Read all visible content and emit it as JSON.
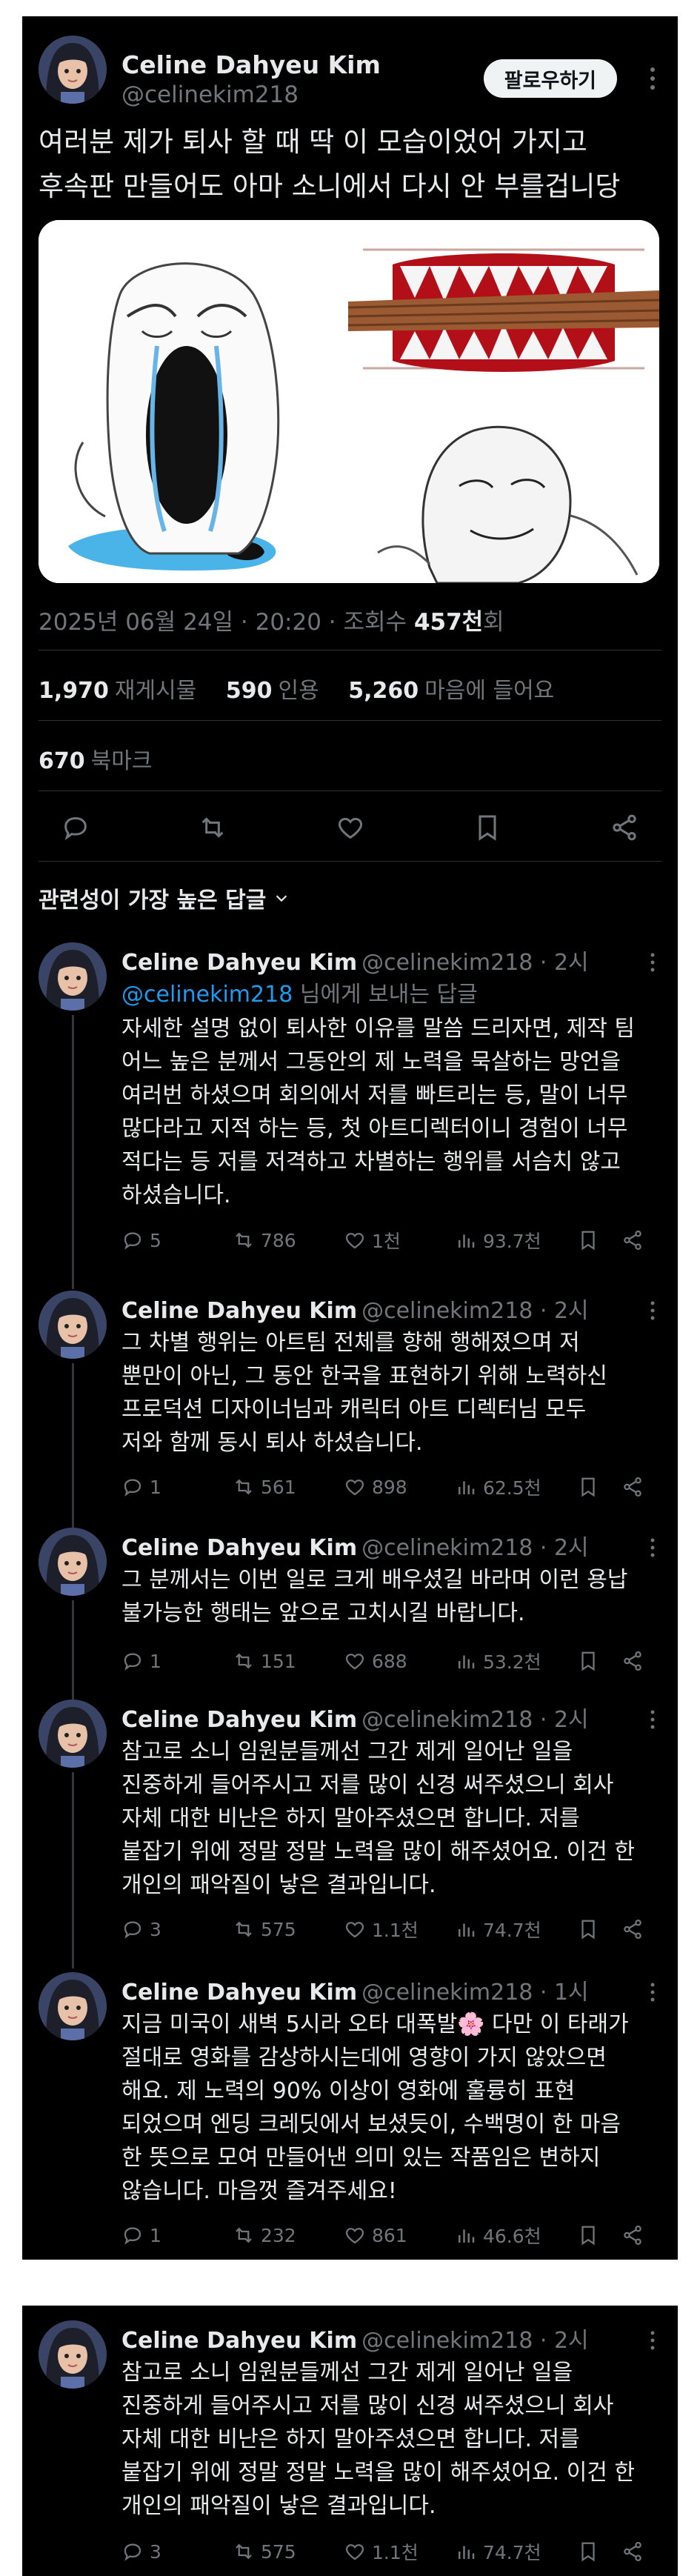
{
  "main": {
    "author_name": "Celine Dahyeu Kim",
    "author_handle": "@celinekim218",
    "follow_label": "팔로우하기",
    "text_line1": "여러분 제가 퇴사 할 때 딱 이 모습이었어 가지고",
    "text_line2": "후속판 만들어도 아마 소니에서 다시 안 부를겁니당",
    "date": "2025년 06월 24일 · 20:20 · 조회수 ",
    "views_value": "457천",
    "views_suffix": "회",
    "retweets_value": "1,970",
    "retweets_label": "재게시물",
    "quotes_value": "590",
    "quotes_label": "인용",
    "likes_value": "5,260",
    "likes_label": "마음에 들어요",
    "bookmarks_value": "670",
    "bookmarks_label": "북마크"
  },
  "sort_label": "관련성이 가장 높은 답글",
  "replies": [
    {
      "name": "Celine Dahyeu Kim",
      "handle": "@celinekim218 · 2시",
      "reply_to": "@celinekim218",
      "reply_to_suffix": " 님에게 보내는 답글",
      "lines": [
        "자세한 설명 없이 퇴사한 이유를 말씀 드리자면, 제작 팀",
        "어느 높은 분께서 그동안의 제 노력을 묵살하는 망언을",
        "여러번 하셨으며 회의에서 저를 빠트리는 등, 말이 너무",
        "많다라고 지적 하는 등, 첫 아트디렉터이니 경험이 너무",
        "적다는 등 저를 저격하고 차별하는 행위를 서슴치 않고",
        "하셨습니다."
      ],
      "replies": "5",
      "retweets": "786",
      "likes": "1천",
      "views": "93.7천"
    },
    {
      "name": "Celine Dahyeu Kim",
      "handle": "@celinekim218 · 2시",
      "lines": [
        "그 차별 행위는 아트팀 전체를 향해 행해졌으며 저",
        "뿐만이 아닌, 그 동안 한국을 표현하기 위해 노력하신",
        "프로덕션 디자이너님과 캐릭터 아트 디렉터님 모두",
        "저와 함께 동시 퇴사 하셨습니다."
      ],
      "replies": "1",
      "retweets": "561",
      "likes": "898",
      "views": "62.5천"
    },
    {
      "name": "Celine Dahyeu Kim",
      "handle": "@celinekim218 · 2시",
      "lines": [
        "그 분께서는 이번 일로 크게 배우셨길 바라며 이런 용납",
        "불가능한 행태는 앞으로 고치시길 바랍니다."
      ],
      "replies": "1",
      "retweets": "151",
      "likes": "688",
      "views": "53.2천"
    },
    {
      "name": "Celine Dahyeu Kim",
      "handle": "@celinekim218 · 2시",
      "lines": [
        "참고로 소니 임원분들께선 그간 제게 일어난 일을",
        "진중하게 들어주시고 저를 많이 신경 써주셨으니 회사",
        "자체 대한 비난은 하지 말아주셨으면 합니다. 저를",
        "붙잡기 위에 정말 정말 노력을 많이 해주셨어요. 이건 한",
        "개인의 패악질이 낳은 결과입니다."
      ],
      "replies": "3",
      "retweets": "575",
      "likes": "1.1천",
      "views": "74.7천"
    },
    {
      "name": "Celine Dahyeu Kim",
      "handle": "@celinekim218 · 1시",
      "lines": [
        "지금 미국이 새벽 5시라 오타 대폭발🌸 다만 이 타래가",
        "절대로 영화를 감상하시는데에 영향이 가지 않았으면",
        "해요. 제 노력의 90% 이상이 영화에 훌륭히 표현",
        "되었으며 엔딩 크레딧에서 보셨듯이, 수백명이 한 마음",
        "한 뜻으로 모여 만들어낸 의미 있는 작품임은 변하지",
        "않습니다. 마음껏 즐겨주세요!"
      ],
      "replies": "1",
      "retweets": "232",
      "likes": "861",
      "views": "46.6천"
    }
  ],
  "repeat_reply": {
    "name": "Celine Dahyeu Kim",
    "handle": "@celinekim218 · 2시",
    "lines": [
      "참고로 소니 임원분들께선 그간 제게 일어난 일을",
      "진중하게 들어주시고 저를 많이 신경 써주셨으니 회사",
      "자체 대한 비난은 하지 말아주셨으면 합니다. 저를",
      "붙잡기 위에 정말 정말 노력을 많이 해주셨어요. 이건 한",
      "개인의 패악질이 낳은 결과입니다."
    ],
    "replies": "3",
    "retweets": "575",
    "likes": "1.1천",
    "views": "74.7천"
  },
  "colors": {
    "background": "#000000",
    "text": "#e7e9ea",
    "muted": "#71767b",
    "link": "#1d9bf0",
    "divider": "#2f3336"
  },
  "icons": [
    "reply-icon",
    "retweet-icon",
    "like-icon",
    "views-icon",
    "bookmark-icon",
    "share-icon",
    "more-icon",
    "chevron-down-icon"
  ]
}
